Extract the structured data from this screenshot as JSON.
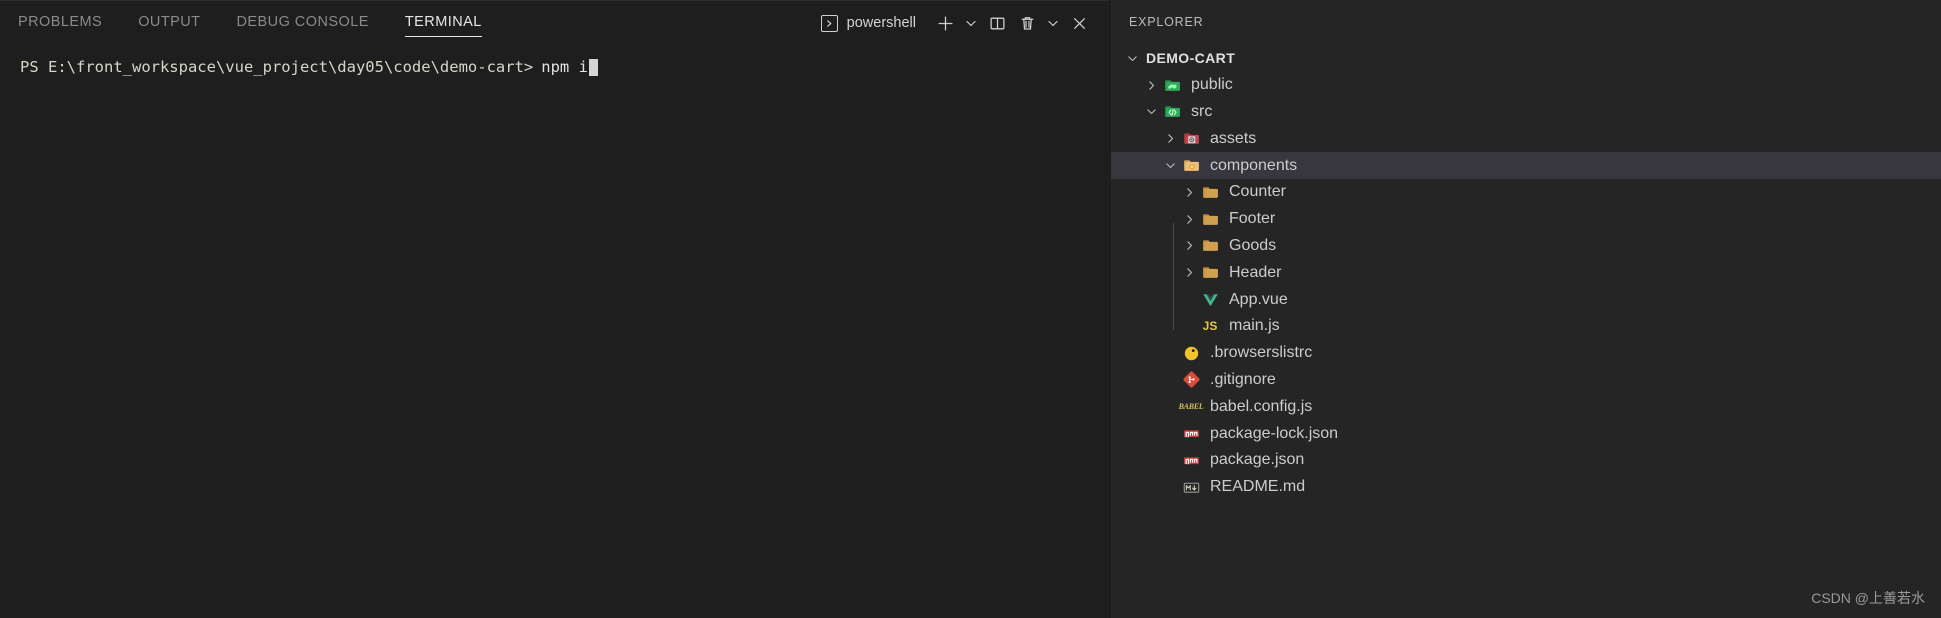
{
  "panel": {
    "tabs": [
      {
        "label": "PROBLEMS",
        "active": false
      },
      {
        "label": "OUTPUT",
        "active": false
      },
      {
        "label": "DEBUG CONSOLE",
        "active": false
      },
      {
        "label": "TERMINAL",
        "active": true
      }
    ],
    "terminal_selector": {
      "icon": "chevron-right-box-icon",
      "icon_glyph": "›",
      "label": "powershell"
    },
    "actions": [
      {
        "name": "new-terminal-button",
        "icon": "plus-icon",
        "glyph": "+"
      },
      {
        "name": "new-terminal-dropdown",
        "icon": "chevron-down-icon",
        "glyph": "⌄"
      },
      {
        "name": "split-terminal-button",
        "icon": "split-panel-icon",
        "glyph": "▥"
      },
      {
        "name": "kill-terminal-button",
        "icon": "trash-icon",
        "glyph": "🗑"
      },
      {
        "name": "panel-views-dropdown",
        "icon": "chevron-down-icon",
        "glyph": "⌄"
      },
      {
        "name": "close-panel-button",
        "icon": "close-icon",
        "glyph": "✕"
      }
    ],
    "terminal": {
      "prompt": "PS E:\\front_workspace\\vue_project\\day05\\code\\demo-cart>",
      "command": "npm i",
      "cursor_visible": true
    }
  },
  "explorer": {
    "title": "EXPLORER",
    "tree": [
      {
        "label": "DEMO-CART",
        "type": "root",
        "depth": 0,
        "twisty": "down",
        "icon": "none",
        "selected": false
      },
      {
        "label": "public",
        "type": "folder",
        "depth": 1,
        "twisty": "right",
        "icon": "folder-public-icon",
        "selected": false
      },
      {
        "label": "src",
        "type": "folder",
        "depth": 1,
        "twisty": "down",
        "icon": "folder-src-icon",
        "selected": false
      },
      {
        "label": "assets",
        "type": "folder",
        "depth": 2,
        "twisty": "right",
        "icon": "folder-assets-icon",
        "selected": false
      },
      {
        "label": "components",
        "type": "folder",
        "depth": 2,
        "twisty": "down",
        "icon": "folder-components-icon",
        "selected": true
      },
      {
        "label": "Counter",
        "type": "folder",
        "depth": 3,
        "twisty": "right",
        "icon": "folder-icon",
        "selected": false
      },
      {
        "label": "Footer",
        "type": "folder",
        "depth": 3,
        "twisty": "right",
        "icon": "folder-icon",
        "selected": false
      },
      {
        "label": "Goods",
        "type": "folder",
        "depth": 3,
        "twisty": "right",
        "icon": "folder-icon",
        "selected": false
      },
      {
        "label": "Header",
        "type": "folder",
        "depth": 3,
        "twisty": "right",
        "icon": "folder-icon",
        "selected": false
      },
      {
        "label": "App.vue",
        "type": "file",
        "depth": 3,
        "twisty": "none",
        "icon": "vue-icon",
        "selected": false
      },
      {
        "label": "main.js",
        "type": "file",
        "depth": 3,
        "twisty": "none",
        "icon": "js-icon",
        "selected": false
      },
      {
        "label": ".browserslistrc",
        "type": "file",
        "depth": 2,
        "twisty": "none",
        "icon": "browserslist-icon",
        "selected": false
      },
      {
        "label": ".gitignore",
        "type": "file",
        "depth": 2,
        "twisty": "none",
        "icon": "git-icon",
        "selected": false
      },
      {
        "label": "babel.config.js",
        "type": "file",
        "depth": 2,
        "twisty": "none",
        "icon": "babel-icon",
        "selected": false
      },
      {
        "label": "package-lock.json",
        "type": "file",
        "depth": 2,
        "twisty": "none",
        "icon": "npm-icon",
        "selected": false
      },
      {
        "label": "package.json",
        "type": "file",
        "depth": 2,
        "twisty": "none",
        "icon": "npm-icon",
        "selected": false
      },
      {
        "label": "README.md",
        "type": "file",
        "depth": 2,
        "twisty": "none",
        "icon": "markdown-icon",
        "selected": false
      }
    ]
  },
  "watermark": {
    "text": "CSDN @上善若水"
  },
  "colors": {
    "panel_bg": "#1e1e1e",
    "explorer_bg": "#252526",
    "selected_row": "#37373d",
    "text": "#cccccc",
    "active_tab": "#e7e7e7",
    "prompt": "#d6d6c8",
    "folder_tan": "#d0a050",
    "green": "#42b883",
    "npm_red": "#cb3837"
  }
}
